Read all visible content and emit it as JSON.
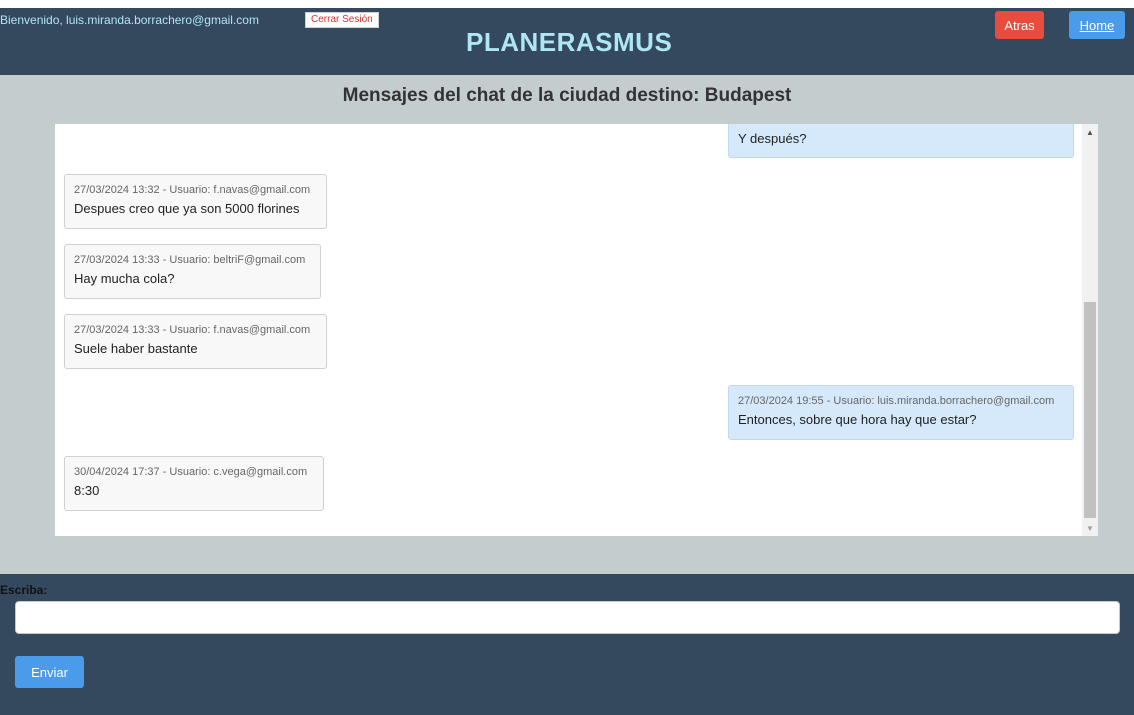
{
  "header": {
    "welcome_text": "Bienvenido, luis.miranda.borrachero@gmail.com",
    "logout_label": "Cerrar Sesión",
    "app_title": "PLANERASMUS",
    "back_label": "Atras",
    "home_label": "Home"
  },
  "main": {
    "heading": "Mensajes del chat de la ciudad destino: Budapest"
  },
  "messages": [
    {
      "meta": "",
      "text": "Y después?",
      "own": true
    },
    {
      "meta": "27/03/2024 13:32 - Usuario: f.navas@gmail.com",
      "text": "Despues creo que ya son 5000 florines",
      "own": false
    },
    {
      "meta": "27/03/2024 13:33 - Usuario: beltriF@gmail.com",
      "text": "Hay mucha cola?",
      "own": false
    },
    {
      "meta": "27/03/2024 13:33 - Usuario: f.navas@gmail.com",
      "text": "Suele haber bastante",
      "own": false
    },
    {
      "meta": "27/03/2024 19:55 - Usuario: luis.miranda.borrachero@gmail.com",
      "text": "Entonces, sobre que hora hay que estar?",
      "own": true
    },
    {
      "meta": "30/04/2024 17:37 - Usuario: c.vega@gmail.com",
      "text": "8:30",
      "own": false
    }
  ],
  "footer": {
    "write_label": "Escriba:",
    "input_value": "",
    "input_placeholder": "",
    "send_label": "Enviar"
  },
  "colors": {
    "header_bg": "#34495e",
    "content_bg": "#c4cdcd",
    "accent_cyan": "#aee6f2",
    "danger": "#e74c3c",
    "primary": "#4a9bea",
    "own_bubble": "#d5e9fb",
    "other_bubble": "#f8f8f8"
  },
  "icons": {
    "scroll_up": "triangle-up",
    "scroll_down": "triangle-down"
  }
}
